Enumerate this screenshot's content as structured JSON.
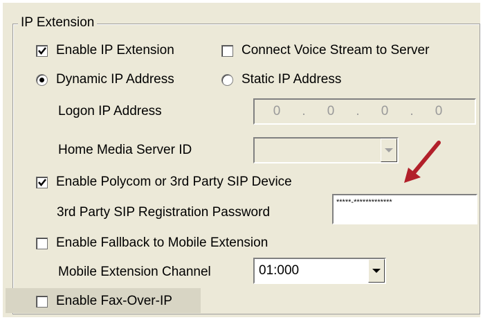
{
  "group": {
    "title": "IP Extension"
  },
  "enable_ip_extension": {
    "label": "Enable IP Extension",
    "checked": true
  },
  "connect_voice_stream": {
    "label": "Connect Voice Stream to Server",
    "checked": false
  },
  "ip_mode": {
    "dynamic_label": "Dynamic IP Address",
    "static_label": "Static IP Address",
    "selected": "dynamic"
  },
  "logon_ip": {
    "label": "Logon IP Address",
    "octets": [
      "0",
      "0",
      "0",
      "0"
    ],
    "separator": "."
  },
  "home_media_server": {
    "label": "Home Media Server ID",
    "value": ""
  },
  "enable_polycom": {
    "label": "Enable Polycom or 3rd Party SIP Device",
    "checked": true
  },
  "sip_password": {
    "label": "3rd Party SIP Registration Password",
    "value": "*****-*************"
  },
  "enable_fallback": {
    "label": "Enable Fallback to Mobile Extension",
    "checked": false
  },
  "mobile_channel": {
    "label": "Mobile Extension Channel",
    "value": "01:000"
  },
  "enable_fax": {
    "label": "Enable Fax-Over-IP",
    "checked": false
  },
  "colors": {
    "annotation_arrow": "#b2202a",
    "panel": "#ece9d8"
  },
  "icons": {
    "checkmark": "checkmark-icon",
    "dropdown": "chevron-down-icon",
    "annotation": "arrow-icon"
  }
}
